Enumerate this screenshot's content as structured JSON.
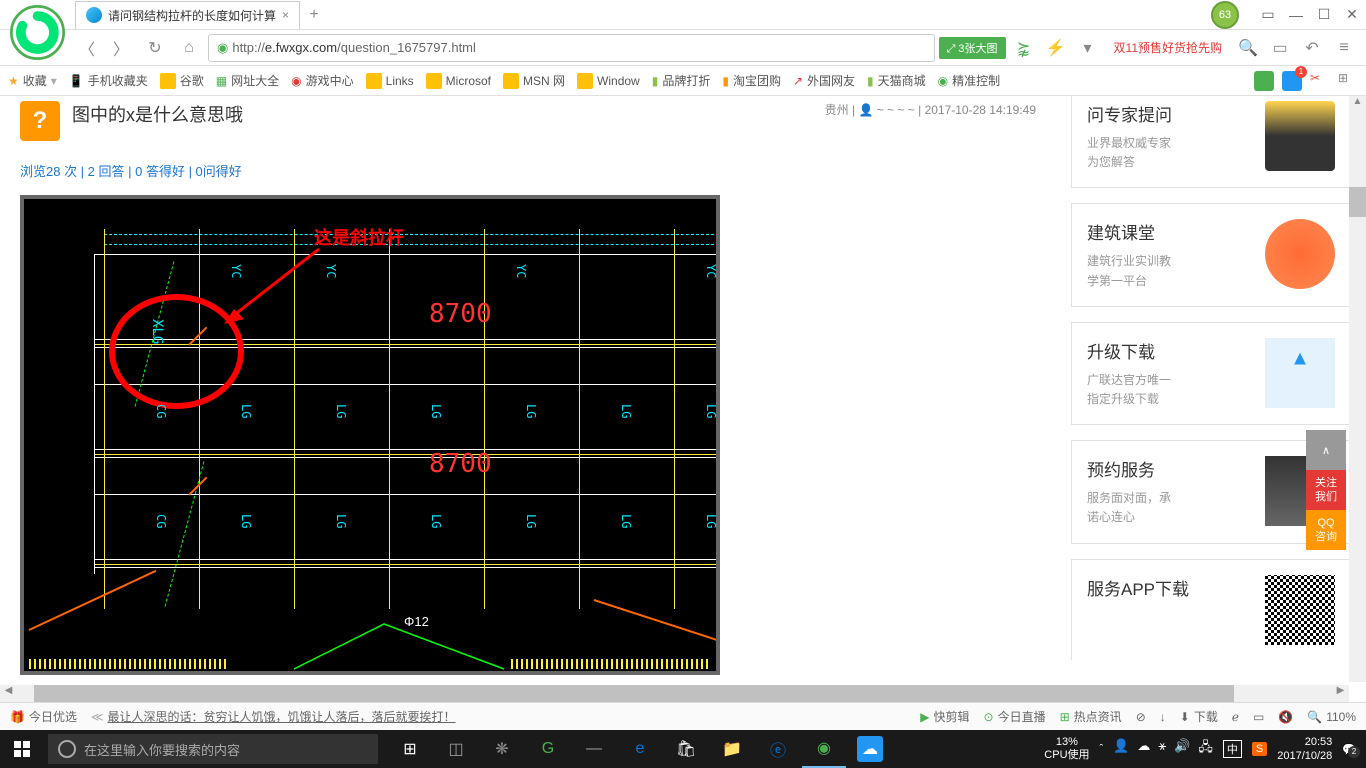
{
  "browser": {
    "tab_title": "请问钢结构拉杆的长度如何计算",
    "shield_count": "63",
    "url_prefix": "http://",
    "url_host": "e.fwxgx.com",
    "url_path": "/question_1675797.html",
    "image_badge": "3张大图",
    "promo_text": "双11预售好货抢先购"
  },
  "bookmarks": {
    "fav": "收藏",
    "items": [
      "手机收藏夹",
      "谷歌",
      "网址大全",
      "游戏中心",
      "Links",
      "Microsof",
      "MSN 网",
      "Window",
      "品牌打折",
      "淘宝团购",
      "外国网友",
      "天猫商城",
      "精准控制"
    ]
  },
  "question": {
    "icon": "?",
    "title_line2": "图中的x是什么意思哦",
    "meta_location": "贵州",
    "meta_user": "~ ~ ~ ~",
    "meta_time": "2017-10-28 14:19:49",
    "stats": "浏览28 次 | 2 回答 | 0 答得好 | 0问得好"
  },
  "cad": {
    "annotation": "这是斜拉杆",
    "dim1": "8700",
    "dim2": "8700",
    "rebar": "Φ12",
    "labels": {
      "xlg": "XLG",
      "yc": "YC",
      "lg": "LG",
      "cg": "CG"
    }
  },
  "sidebar": {
    "card1": {
      "title": "问专家提问",
      "desc1": "业界最权威专家",
      "desc2": "为您解答"
    },
    "card2": {
      "title": "建筑课堂",
      "desc1": "建筑行业实训教",
      "desc2": "学第一平台"
    },
    "card3": {
      "title": "升级下载",
      "desc1": "广联达官方唯一",
      "desc2": "指定升级下载"
    },
    "card4": {
      "title": "预约服务",
      "desc1": "服务面对面，承",
      "desc2": "诺心连心"
    },
    "card5": {
      "title": "服务APP下载"
    }
  },
  "float": {
    "top": "∧",
    "follow": "关注\n我们",
    "qq": "QQ\n咨询"
  },
  "statusbar": {
    "today": "今日优选",
    "quote": "最让人深思的话：贫穷让人饥饿，饥饿让人落后，落后就要挨打！",
    "items": [
      "快剪辑",
      "今日直播",
      "热点资讯",
      "",
      "",
      "下载",
      "",
      "",
      ""
    ],
    "zoom": "110%"
  },
  "taskbar": {
    "cortana": "在这里输入你要搜索的内容",
    "cpu_pct": "13%",
    "cpu_label": "CPU使用",
    "ime": "中",
    "time": "20:53",
    "date": "2017/10/28",
    "notif": "2"
  }
}
